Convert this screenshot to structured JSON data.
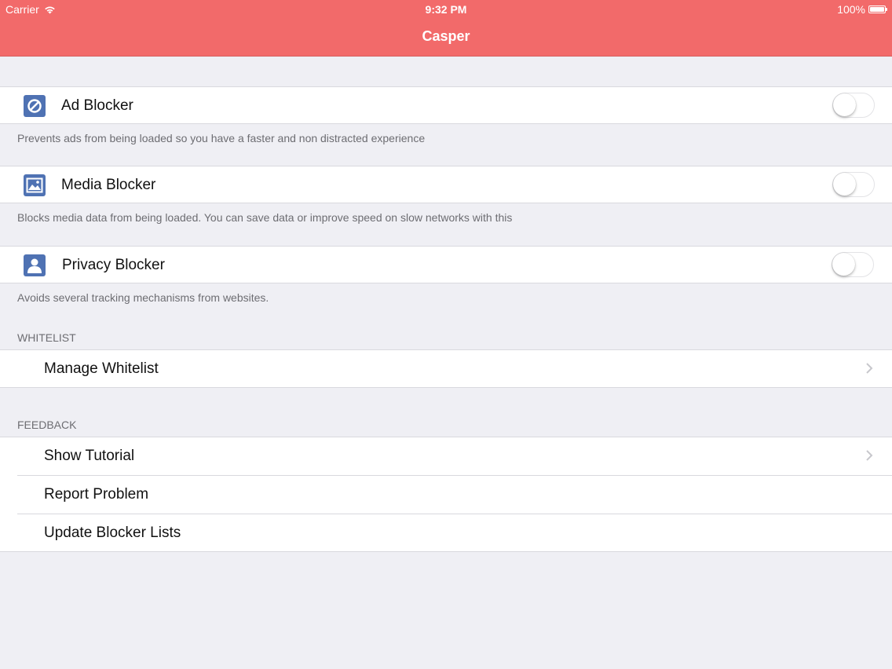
{
  "status_bar": {
    "carrier": "Carrier",
    "time": "9:32 PM",
    "battery": "100%"
  },
  "nav": {
    "title": "Casper"
  },
  "blockers": [
    {
      "label": "Ad Blocker",
      "icon": "no-entry-icon",
      "enabled": false,
      "description": "Prevents ads from being loaded so you have a faster and non distracted experience"
    },
    {
      "label": "Media Blocker",
      "icon": "image-icon",
      "enabled": false,
      "description": "Blocks media data from being loaded. You can save data or improve speed on slow networks with this"
    },
    {
      "label": "Privacy Blocker",
      "icon": "person-icon",
      "enabled": false,
      "description": "Avoids several tracking mechanisms from websites."
    }
  ],
  "whitelist": {
    "header": "WHITELIST",
    "items": [
      {
        "label": "Manage Whitelist",
        "chevron": true
      }
    ]
  },
  "feedback": {
    "header": "FEEDBACK",
    "items": [
      {
        "label": "Show Tutorial",
        "chevron": true
      },
      {
        "label": "Report Problem",
        "chevron": false
      },
      {
        "label": "Update Blocker Lists",
        "chevron": false
      }
    ]
  },
  "colors": {
    "nav_background": "#f26a6a",
    "icon_blue": "#4f72b3",
    "background": "#efeff4"
  }
}
